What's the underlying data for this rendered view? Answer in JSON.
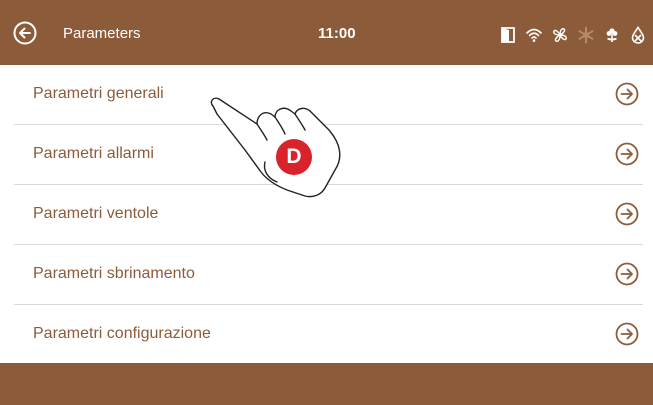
{
  "header": {
    "title": "Parameters",
    "time": "11:00"
  },
  "status_icons": [
    "door-icon",
    "wifi-icon",
    "fan-icon",
    "snowflake-icon",
    "plant-icon",
    "no-defrost-icon"
  ],
  "menu": {
    "items": [
      {
        "label": "Parametri generali"
      },
      {
        "label": "Parametri allarmi"
      },
      {
        "label": "Parametri ventole"
      },
      {
        "label": "Parametri sbrinamento"
      },
      {
        "label": "Parametri configurazione"
      }
    ]
  },
  "annotation": {
    "badge": "D"
  },
  "colors": {
    "brand": "#8c5b39",
    "badge": "#d8232a",
    "divider": "#d9d9d9"
  }
}
